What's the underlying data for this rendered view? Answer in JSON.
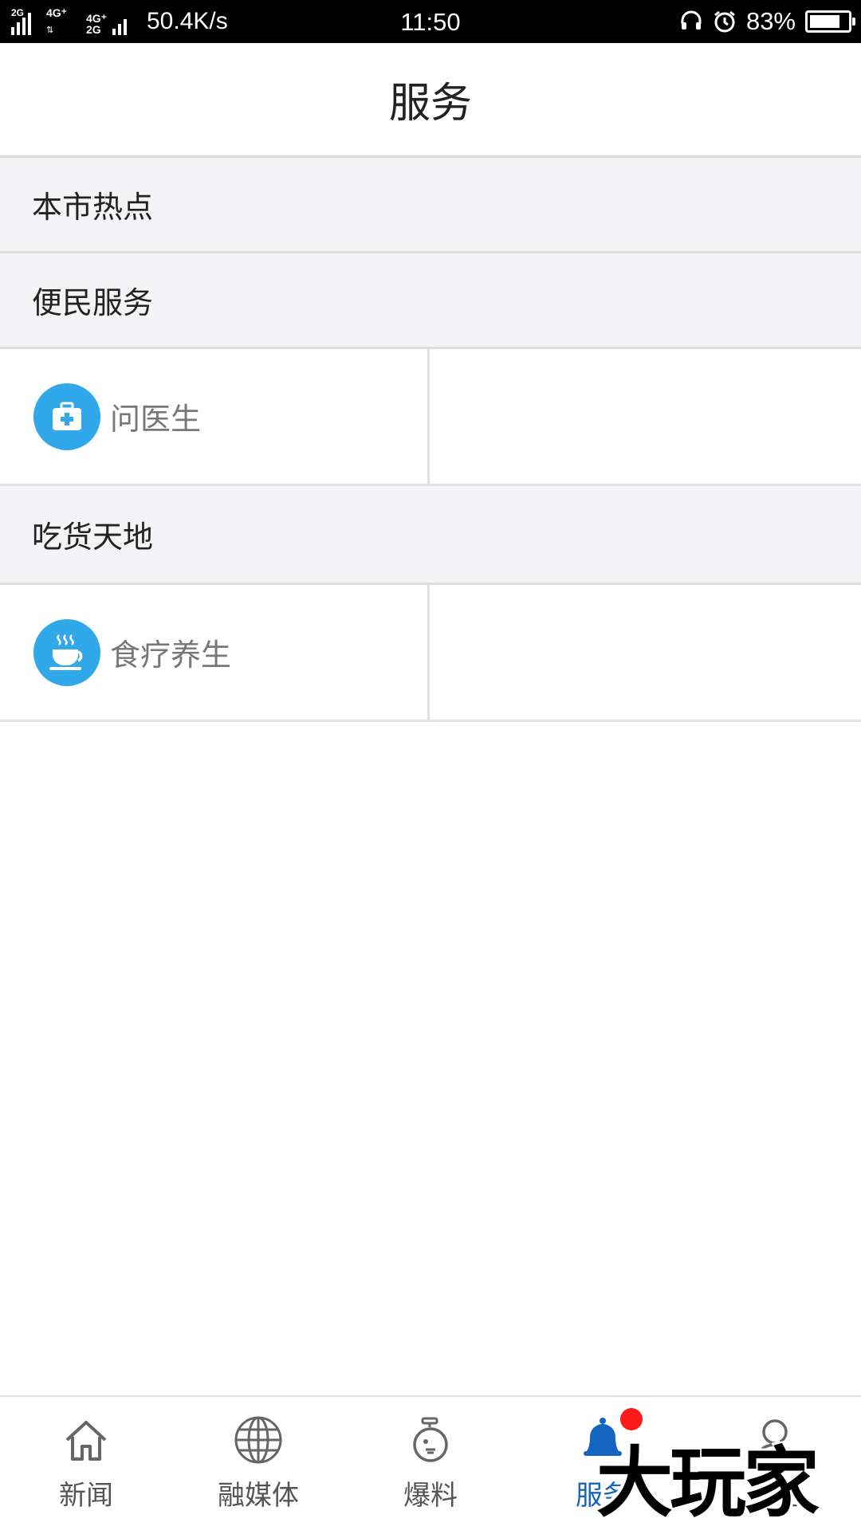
{
  "status_bar": {
    "net1": "2G",
    "net2": "4G⁺",
    "net3_top": "4G⁺",
    "net3_bottom": "2G",
    "speed": "50.4K/s",
    "time": "11:50",
    "battery_pct": "83%",
    "battery_level": 0.83
  },
  "header": {
    "title": "服务"
  },
  "sections": [
    {
      "title": "本市热点",
      "items": []
    },
    {
      "title": "便民服务",
      "items": [
        {
          "label": "问医生",
          "icon": "medical-kit-icon"
        }
      ]
    },
    {
      "title": "吃货天地",
      "items": [
        {
          "label": "食疗养生",
          "icon": "tea-cup-icon"
        }
      ]
    }
  ],
  "bottom_nav": {
    "items": [
      {
        "label": "新闻",
        "icon": "home-icon",
        "active": false
      },
      {
        "label": "融媒体",
        "icon": "globe-icon",
        "active": false
      },
      {
        "label": "爆料",
        "icon": "microphone-icon",
        "active": false
      },
      {
        "label": "服务",
        "icon": "bell-icon",
        "active": true,
        "badge": true
      },
      {
        "label": "我的",
        "icon": "person-icon",
        "active": false
      }
    ]
  },
  "colors": {
    "accent": "#1565c0",
    "icon_bg": "#30a8ea",
    "badge": "#ff1a1a",
    "section_bg": "#f4f4f6"
  },
  "watermark": "大玩家"
}
